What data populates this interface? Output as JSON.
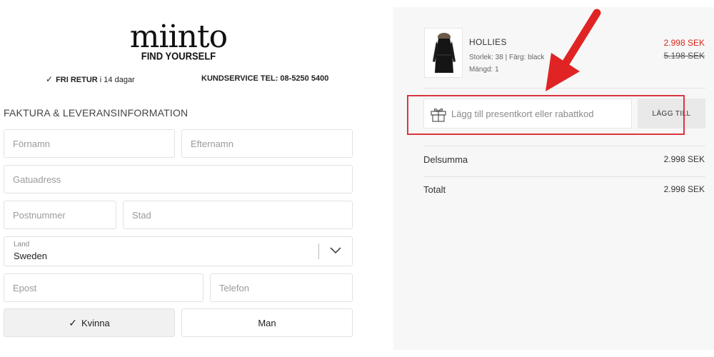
{
  "header": {
    "logo": "miinto",
    "tagline": "FIND YOURSELF",
    "perk_return_bold": "FRI RETUR",
    "perk_return_rest": "i 14 dagar",
    "perk_service": "KUNDSERVICE TEL: 08-5250 5400"
  },
  "form": {
    "title": "FAKTURA & LEVERANSINFORMATION",
    "first_name_placeholder": "Förnamn",
    "last_name_placeholder": "Efternamn",
    "street_placeholder": "Gatuadress",
    "zip_placeholder": "Postnummer",
    "city_placeholder": "Stad",
    "country_label": "Land",
    "country_value": "Sweden",
    "email_placeholder": "Epost",
    "phone_placeholder": "Telefon",
    "gender_female": "Kvinna",
    "gender_male": "Man",
    "gender_selected": "Kvinna"
  },
  "cart": {
    "product_name": "HOLLIES",
    "product_meta": "Storlek: 38  |  Färg: black",
    "product_qty": "Mängd: 1",
    "price_sale": "2.998 SEK",
    "price_original": "5.198 SEK",
    "gift_placeholder": "Lägg till presentkort eller rabattkod",
    "add_button": "LÄGG TILL",
    "subtotal_label": "Delsumma",
    "subtotal_value": "2.998 SEK",
    "total_label": "Totalt",
    "total_value": "2.998 SEK"
  },
  "colors": {
    "sale_price": "#d8261c",
    "highlight": "#d9363e",
    "arrow": "#e02424",
    "panel_bg": "#f7f7f7"
  },
  "icons": {
    "check": "check-icon",
    "chevron": "chevron-down-icon",
    "gift": "gift-icon",
    "arrow": "annotation-arrow"
  }
}
